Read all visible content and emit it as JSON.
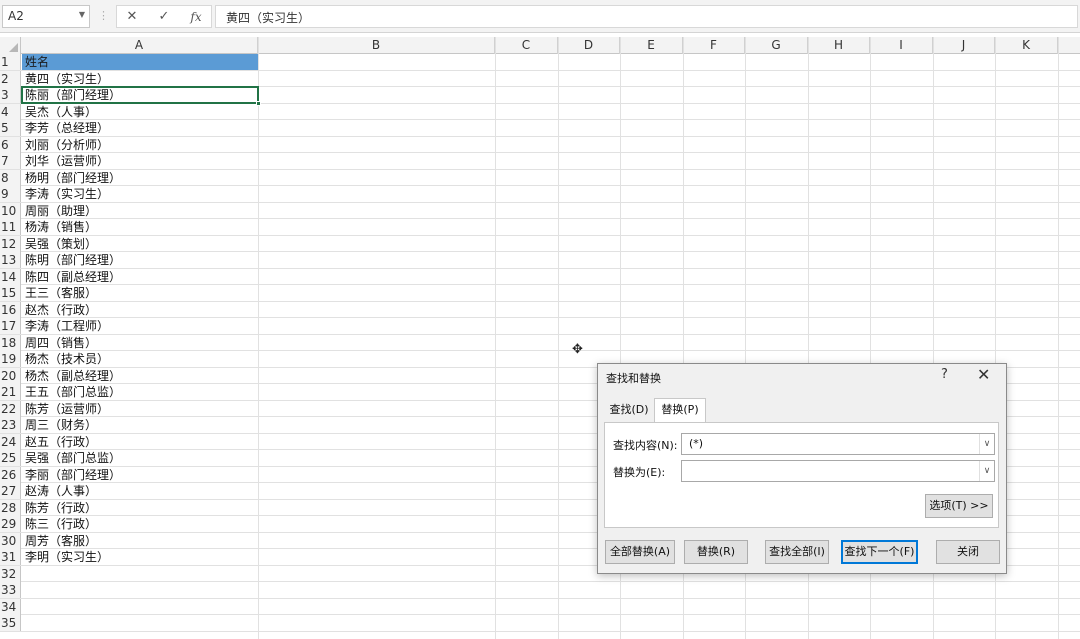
{
  "formula_bar": {
    "name_box": "A2",
    "separator": "⋮",
    "cancel_glyph": "✕",
    "confirm_glyph": "✓",
    "fx_glyph": "fx",
    "formula_value": "黄四（实习生）"
  },
  "columns": [
    "A",
    "B",
    "C",
    "D",
    "E",
    "F",
    "G",
    "H",
    "I",
    "J",
    "K"
  ],
  "rows": [
    {
      "num": "1",
      "value": "姓名"
    },
    {
      "num": "2",
      "value": "黄四（实习生）"
    },
    {
      "num": "3",
      "value": "陈丽（部门经理）"
    },
    {
      "num": "4",
      "value": "吴杰（人事）"
    },
    {
      "num": "5",
      "value": "李芳（总经理）"
    },
    {
      "num": "6",
      "value": "刘丽（分析师）"
    },
    {
      "num": "7",
      "value": "刘华（运营师）"
    },
    {
      "num": "8",
      "value": "杨明（部门经理）"
    },
    {
      "num": "9",
      "value": "李涛（实习生）"
    },
    {
      "num": "10",
      "value": "周丽（助理）"
    },
    {
      "num": "11",
      "value": "杨涛（销售）"
    },
    {
      "num": "12",
      "value": "吴强（策划）"
    },
    {
      "num": "13",
      "value": "陈明（部门经理）"
    },
    {
      "num": "14",
      "value": "陈四（副总经理）"
    },
    {
      "num": "15",
      "value": "王三（客服）"
    },
    {
      "num": "16",
      "value": "赵杰（行政）"
    },
    {
      "num": "17",
      "value": "李涛（工程师）"
    },
    {
      "num": "18",
      "value": "周四（销售）"
    },
    {
      "num": "19",
      "value": "杨杰（技术员）"
    },
    {
      "num": "20",
      "value": "杨杰（副总经理）"
    },
    {
      "num": "21",
      "value": "王五（部门总监）"
    },
    {
      "num": "22",
      "value": "陈芳（运营师）"
    },
    {
      "num": "23",
      "value": "周三（财务）"
    },
    {
      "num": "24",
      "value": "赵五（行政）"
    },
    {
      "num": "25",
      "value": "吴强（部门总监）"
    },
    {
      "num": "26",
      "value": "李丽（部门经理）"
    },
    {
      "num": "27",
      "value": "赵涛（人事）"
    },
    {
      "num": "28",
      "value": "陈芳（行政）"
    },
    {
      "num": "29",
      "value": "陈三（行政）"
    },
    {
      "num": "30",
      "value": "周芳（客服）"
    },
    {
      "num": "31",
      "value": "李明（实习生）"
    },
    {
      "num": "32",
      "value": ""
    },
    {
      "num": "33",
      "value": ""
    },
    {
      "num": "34",
      "value": ""
    },
    {
      "num": "35",
      "value": ""
    }
  ],
  "selected_cell": "A2",
  "header_fill_color": "#5b9bd5",
  "selection_color": "#217346",
  "cursor_glyph": "✥",
  "dialog": {
    "title": "查找和替换",
    "help": "?",
    "close": "✕",
    "tabs": [
      "查找(D)",
      "替换(P)"
    ],
    "active_tab": "替换(P)",
    "find_label": "查找内容(N):",
    "find_value": "(*)",
    "replace_label": "替换为(E):",
    "replace_value": "",
    "dropdown_glyph": "∨",
    "options_button": "选项(T) >>",
    "buttons": {
      "replace_all": "全部替换(A)",
      "replace": "替换(R)",
      "find_all": "查找全部(I)",
      "find_next": "查找下一个(F)",
      "close": "关闭"
    }
  }
}
